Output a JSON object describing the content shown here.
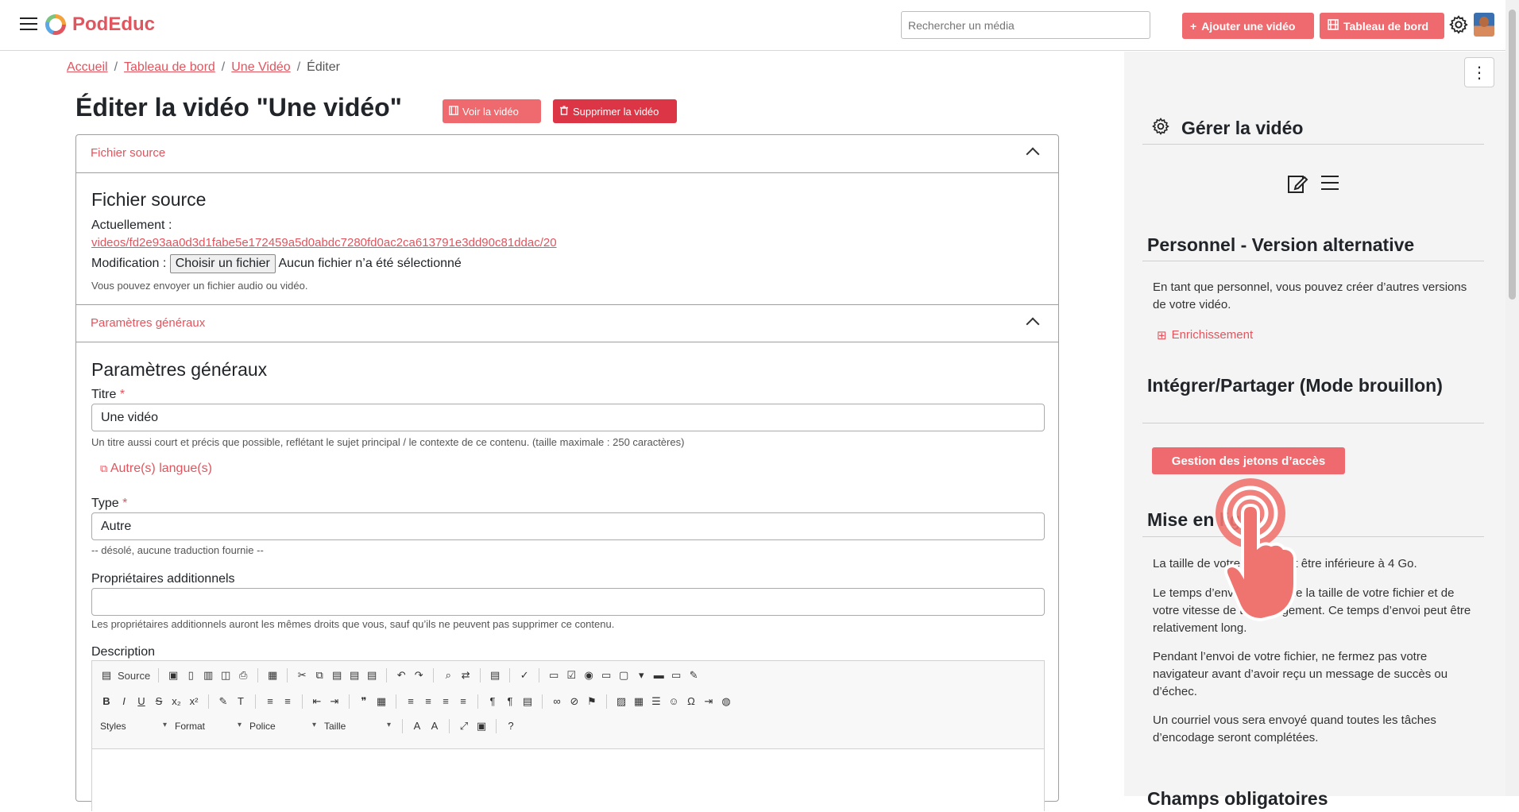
{
  "header": {
    "app_name": "PodEduc",
    "search_placeholder": "Rechercher un média",
    "add_video_label": "Ajouter une vidéo",
    "dashboard_label": "Tableau de bord",
    "accent_color": "#ef6a6e"
  },
  "breadcrumb": {
    "items": [
      "Accueil",
      "Tableau de bord",
      "Une Vidéo"
    ],
    "current": "Éditer"
  },
  "page": {
    "title": "Éditer la vidéo \"Une vidéo\"",
    "view_video_label": "Voir la vidéo",
    "delete_video_label": "Supprimer la vidéo"
  },
  "source_file": {
    "accordion_label": "Fichier source",
    "heading": "Fichier source",
    "current_label": "Actuellement :",
    "current_link": "videos/fd2e93aa0d3d1fabe5e172459a5d0abdc7280fd0ac2ca613791e3dd90c81ddac/20",
    "modify_label": "Modification :",
    "choose_file_label": "Choisir un fichier",
    "no_file_text": "Aucun fichier n’a été sélectionné",
    "help": "Vous pouvez envoyer un fichier audio ou vidéo."
  },
  "general": {
    "accordion_label": "Paramètres généraux",
    "heading": "Paramètres généraux",
    "title_label": "Titre",
    "title_value": "Une vidéo",
    "title_help": "Un titre aussi court et précis que possible, reflétant le sujet principal / le contexte de ce contenu. (taille maximale : 250 caractères)",
    "other_languages_label": "Autre(s) langue(s)",
    "type_label": "Type",
    "type_value": "Autre",
    "type_help": "-- désolé, aucune traduction fournie --",
    "owners_label": "Propriétaires additionnels",
    "owners_value": "",
    "owners_help": "Les propriétaires additionnels auront les mêmes droits que vous, sauf qu’ils ne peuvent pas supprimer ce contenu.",
    "description_label": "Description",
    "required_mark": "*"
  },
  "editor": {
    "source_label": "Source",
    "combos": [
      "Styles",
      "Format",
      "Police",
      "Taille"
    ]
  },
  "sidebar": {
    "manage_title": "Gérer la vidéo",
    "staff_title": "Personnel - Version alternative",
    "staff_text": "En tant que personnel, vous pouvez créer d’autres versions de votre vidéo.",
    "enrichment_label": "Enrichissement",
    "share_title": "Intégrer/Partager (Mode brouillon)",
    "tokens_button": "Gestion des jetons d’accès",
    "online_title": "Mise en ligne",
    "online_p1": "La taille de votre fichier doit être inférieure à 4 Go.",
    "online_p2": "Le temps d’envoi dépend de la taille de votre fichier et de votre vitesse de téléchargement. Ce temps d’envoi peut être relativement long.",
    "online_p3": "Pendant l’envoi de votre fichier, ne fermez pas votre navigateur avant d’avoir reçu un message de succès ou d’échec.",
    "online_p4": "Un courriel vous sera envoyé quand toutes les tâches d’encodage seront complétées.",
    "next_title": "Champs obligatoires"
  }
}
